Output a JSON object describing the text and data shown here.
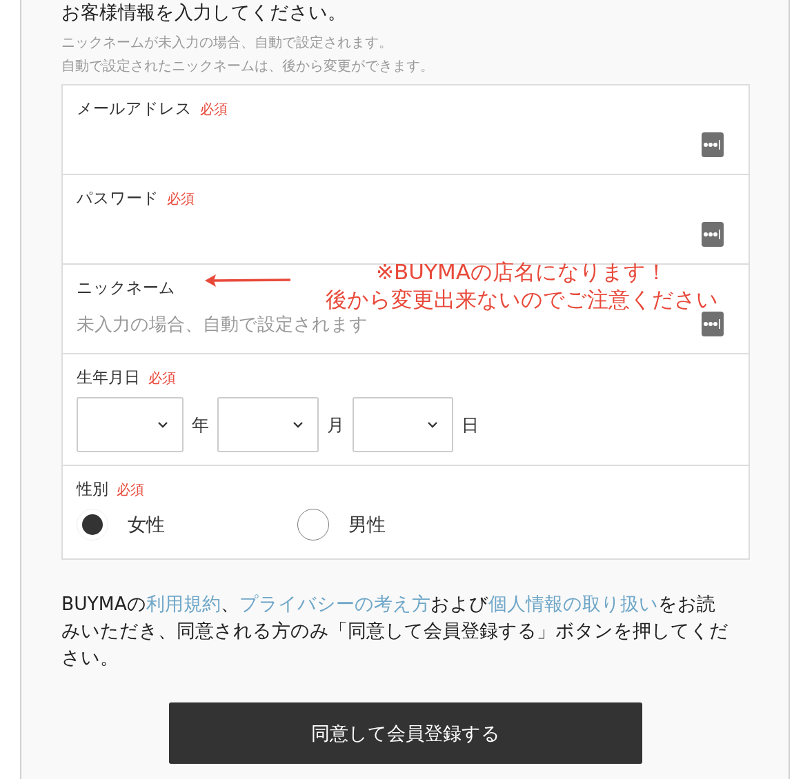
{
  "heading": "お客様情報を入力してください。",
  "notes": [
    "ニックネームが未入力の場合、自動で設定されます。",
    "自動で設定されたニックネームは、後から変更ができます。"
  ],
  "fields": [
    {
      "kind": "text",
      "label": "メールアドレス",
      "badge": "必須"
    },
    {
      "kind": "text",
      "label": "パスワード",
      "badge": "必須"
    },
    {
      "kind": "text",
      "label": "ニックネーム",
      "placeholder": "未入力の場合、自動で設定されます"
    },
    {
      "kind": "date",
      "label": "生年月日",
      "badge": "必須",
      "parts": [
        {
          "unit": "年"
        },
        {
          "unit": "月"
        },
        {
          "unit": "日"
        }
      ]
    },
    {
      "kind": "radio",
      "label": "性別",
      "badge": "必須",
      "options": [
        {
          "label": "女性",
          "selected": true
        },
        {
          "label": "男性",
          "selected": false
        }
      ]
    }
  ],
  "annotation": {
    "lines": [
      "※BUYMAの店名になります！",
      "後から変更出来ないのでご注意ください"
    ]
  },
  "agreement": [
    {
      "kind": "text",
      "text": "BUYMAの"
    },
    {
      "kind": "link",
      "text": "利用規約"
    },
    {
      "kind": "text",
      "text": "、"
    },
    {
      "kind": "link",
      "text": "プライバシーの考え方"
    },
    {
      "kind": "text",
      "text": "および"
    },
    {
      "kind": "link",
      "text": "個人情報の取り扱い"
    },
    {
      "kind": "text",
      "text": "をお読みいただき、同意される方のみ「同意して会員登録する」ボタンを押してください。"
    }
  ],
  "submit": "同意して会員登録する"
}
